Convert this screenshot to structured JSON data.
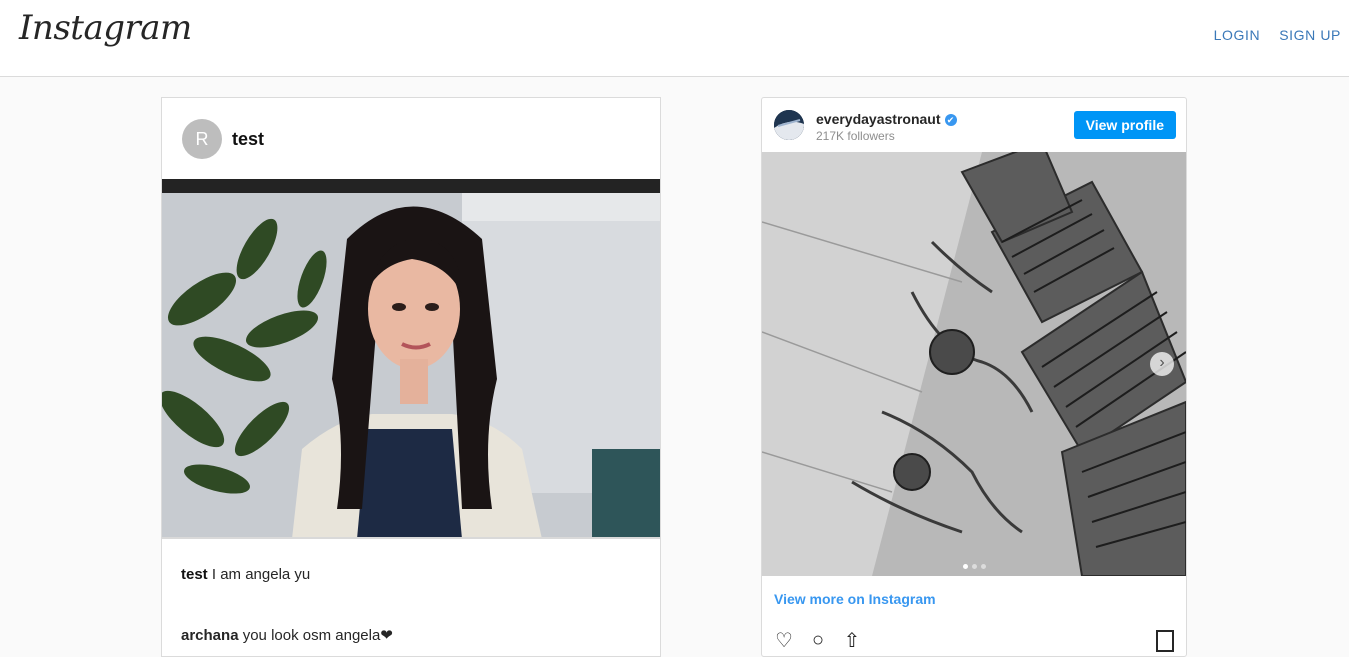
{
  "header": {
    "logo": "Instagram",
    "login_label": "LOGIN",
    "signup_label": "SIGN UP"
  },
  "post": {
    "avatar_letter": "R",
    "username": "test",
    "caption_user": "test",
    "caption_text": " I am angela yu",
    "comment_user": "archana",
    "comment_text": " you look osm angela❤"
  },
  "embed": {
    "account": "everydayastronaut",
    "followers": "217K followers",
    "view_profile_label": "View profile",
    "view_more_label": "View more on Instagram",
    "verified_icon": "✔",
    "next_icon": "›",
    "like_icon": "♡",
    "comment_icon": "○",
    "share_icon": "⇧"
  },
  "colors": {
    "link": "#3a78b8",
    "button": "#0095f6",
    "border": "#dbdbdb"
  }
}
